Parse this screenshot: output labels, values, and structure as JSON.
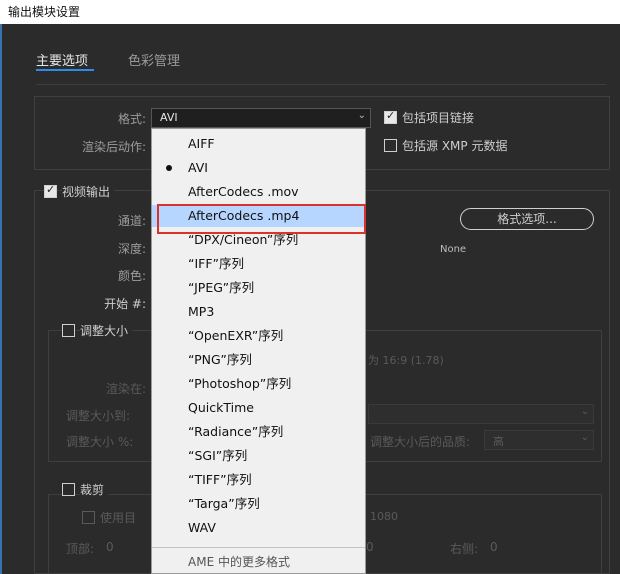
{
  "window": {
    "title": "输出模块设置"
  },
  "tabs": [
    {
      "label": "主要选项",
      "active": true
    },
    {
      "label": "色彩管理",
      "active": false
    }
  ],
  "format": {
    "label": "格式:",
    "value": "AVI",
    "post_render_label": "渲染后动作:"
  },
  "options": {
    "include_project_link": {
      "label": "包括项目链接",
      "checked": true
    },
    "include_xmp": {
      "label": "包括源 XMP 元数据",
      "checked": false
    }
  },
  "video_output": {
    "label": "视频输出",
    "checked": true,
    "channels_label": "通道:",
    "depth_label": "深度:",
    "color_label": "颜色:",
    "start_label": "开始 #:",
    "format_options_button": "格式选项...",
    "codec_value": "None"
  },
  "resize": {
    "label": "调整大小",
    "checked": false,
    "ratio_text": "为 16:9 (1.78)",
    "render_at_label": "渲染在:",
    "resize_to_label": "调整大小到:",
    "resize_pct_label": "调整大小 %:",
    "quality_label": "调整大小后的品质:",
    "quality_value": "高"
  },
  "crop": {
    "label": "裁剪",
    "checked": false,
    "use_region_label": "使用目",
    "size_text": "1080",
    "top_label": "顶部:",
    "top_value": "0",
    "right_label": "右侧:",
    "right_value": "0",
    "bottom_value": "0"
  },
  "dropdown": {
    "selected": "AVI",
    "highlighted": "AfterCodecs .mp4",
    "items": [
      "AIFF",
      "AVI",
      "AfterCodecs .mov",
      "AfterCodecs .mp4",
      "“DPX/Cineon”序列",
      "“IFF”序列",
      "“JPEG”序列",
      "MP3",
      "“OpenEXR”序列",
      "“PNG”序列",
      "“Photoshop”序列",
      "QuickTime",
      "“Radiance”序列",
      "“SGI”序列",
      "“TIFF”序列",
      "“Targa”序列",
      "WAV"
    ],
    "more_formats": "AME 中的更多格式"
  },
  "colors": {
    "accent": "#2d8ceb",
    "highlight": "#b6d6ff",
    "callout": "#d9342b"
  }
}
